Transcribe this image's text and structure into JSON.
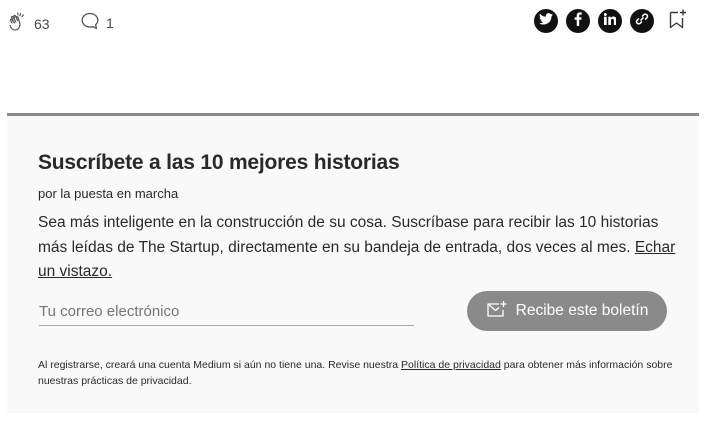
{
  "actions": {
    "clap_count": "63",
    "response_count": "1",
    "share_icons": [
      "twitter-icon",
      "facebook-icon",
      "linkedin-icon",
      "link-icon"
    ],
    "bookmark_icon": "bookmark-add-icon"
  },
  "newsletter": {
    "title": "Suscríbete a las 10 mejores historias",
    "byline": "por la puesta en marcha",
    "description": "Sea más inteligente en la construcción de su cosa. Suscríbase para recibir las 10 historias más leídas de The Startup, directamente en su bandeja de entrada, dos veces al mes.",
    "preview_link": "Echar un vistazo.",
    "email_placeholder": "Tu correo electrónico",
    "email_value": "",
    "subscribe_label": "Recibe este boletín",
    "legal_prefix": "Al registrarse, creará una cuenta Medium si aún no tiene una. Revise nuestra",
    "privacy_link": "Política de privacidad",
    "legal_suffix": "para obtener más información sobre nuestras prácticas de privacidad."
  },
  "colors": {
    "button_bg": "#8a8a8a",
    "divider": "#8a8a8a",
    "panel_bg": "#f9f9f9",
    "icon_dark": "#111111"
  }
}
